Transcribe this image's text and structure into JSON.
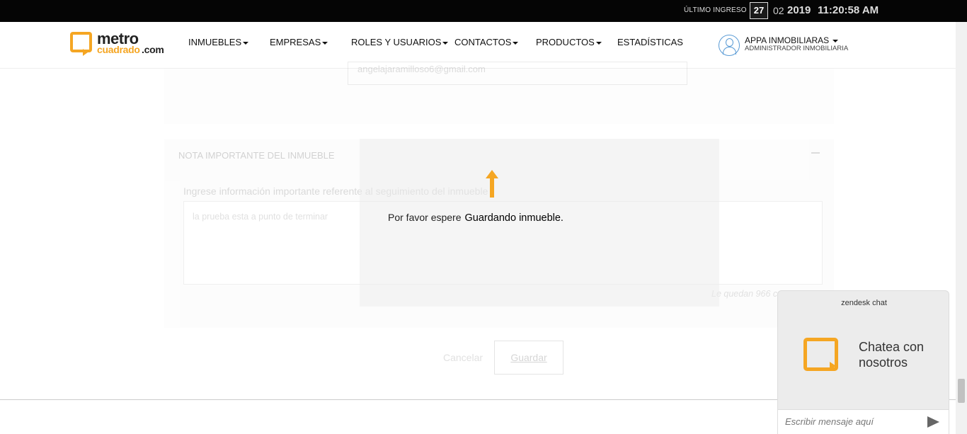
{
  "topbar": {
    "last_login_label": "ÚLTIMO INGRESO",
    "day": "27",
    "month": "02",
    "year": "2019",
    "time": "11:20:58 AM"
  },
  "logo": {
    "line1": "metro",
    "line2a": "cuadrado",
    "line2b": ".com"
  },
  "nav": {
    "items": [
      {
        "label": "INMUEBLES",
        "dropdown": true
      },
      {
        "label": "EMPRESAS",
        "dropdown": true
      },
      {
        "label": "ROLES Y USUARIOS",
        "dropdown": true
      },
      {
        "label": "CONTACTOS",
        "dropdown": true
      },
      {
        "label": "PRODUCTOS",
        "dropdown": true
      },
      {
        "label": "ESTADÍSTICAS",
        "dropdown": false
      }
    ]
  },
  "user": {
    "name": "APPA INMOBILIARAS",
    "role": "ADMINISTRADOR INMOBILIARIA"
  },
  "form": {
    "email_value": "angelajaramilloso6@gmail.com",
    "section_title": "NOTA IMPORTANTE DEL INMUEBLE",
    "hint": "Ingrese información importante referente al seguimiento del inmueble",
    "note_value": "la prueba esta a punto de terminar",
    "counter": "Le quedan 966 caracteres",
    "cancel_label": "Cancelar",
    "save_label": "Guardar"
  },
  "loader": {
    "prefix": "Por favor espere",
    "message": "Guardando inmueble."
  },
  "chat": {
    "brand": "zendesk chat",
    "title": "Chatea con nosotros",
    "placeholder": "Escribir mensaje aquí"
  },
  "colors": {
    "accent": "#f5a623",
    "topbar": "#050505"
  }
}
